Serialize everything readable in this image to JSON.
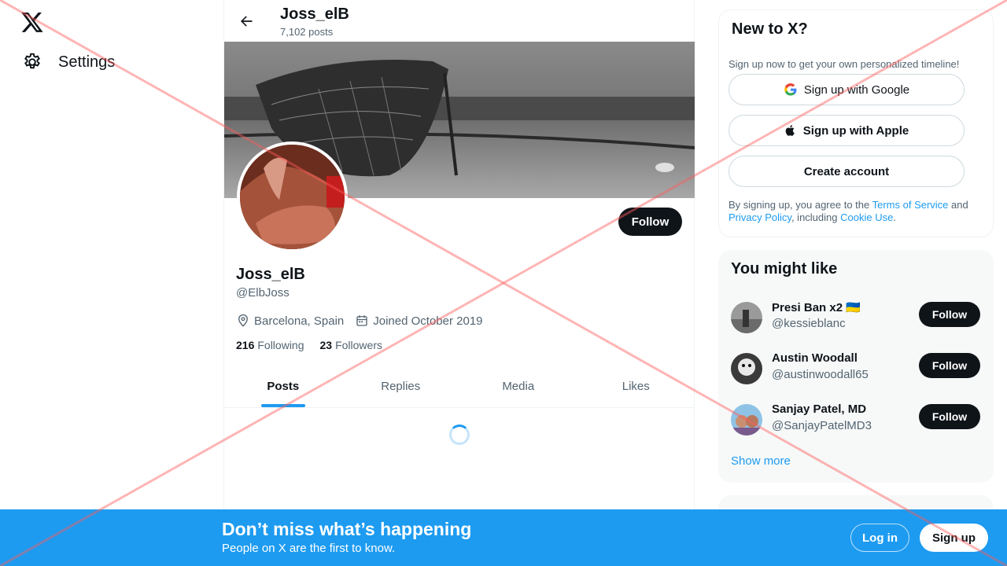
{
  "nav": {
    "logo_icon": "x-logo-icon",
    "settings_label": "Settings"
  },
  "header": {
    "name": "Joss_elB",
    "post_count": "7,102 posts"
  },
  "profile": {
    "follow_label": "Follow",
    "name": "Joss_elB",
    "handle": "@ElbJoss",
    "location": "Barcelona, Spain",
    "joined": "Joined October 2019",
    "following_count": "216",
    "following_label": "Following",
    "followers_count": "23",
    "followers_label": "Followers"
  },
  "tabs": [
    {
      "label": "Posts",
      "active": true
    },
    {
      "label": "Replies",
      "active": false
    },
    {
      "label": "Media",
      "active": false
    },
    {
      "label": "Likes",
      "active": false
    }
  ],
  "signup_card": {
    "title": "New to X?",
    "subtitle": "Sign up now to get your own personalized timeline!",
    "google_label": "Sign up with Google",
    "apple_label": "Sign up with Apple",
    "create_label": "Create account",
    "terms_prefix": "By signing up, you agree to the ",
    "terms_link": "Terms of Service",
    "terms_and": " and ",
    "privacy_link": "Privacy Policy",
    "terms_including": ", including ",
    "cookie_link": "Cookie Use",
    "terms_end": "."
  },
  "suggestions": {
    "title": "You might like",
    "users": [
      {
        "name": "Presi Ban x2",
        "flag": "🇺🇦",
        "handle": "@kessieblanc",
        "follow_label": "Follow"
      },
      {
        "name": "Austin Woodall",
        "flag": "",
        "handle": "@austinwoodall65",
        "follow_label": "Follow"
      },
      {
        "name": "Sanjay Patel, MD",
        "flag": "",
        "handle": "@SanjayPatelMD3",
        "follow_label": "Follow"
      }
    ],
    "show_more": "Show more"
  },
  "bottom_bar": {
    "title": "Don’t miss what’s happening",
    "subtitle": "People on X are the first to know.",
    "login_label": "Log in",
    "signup_label": "Sign up"
  },
  "colors": {
    "accent": "#1d9bf0",
    "text": "#0f1419",
    "muted": "#536471"
  }
}
